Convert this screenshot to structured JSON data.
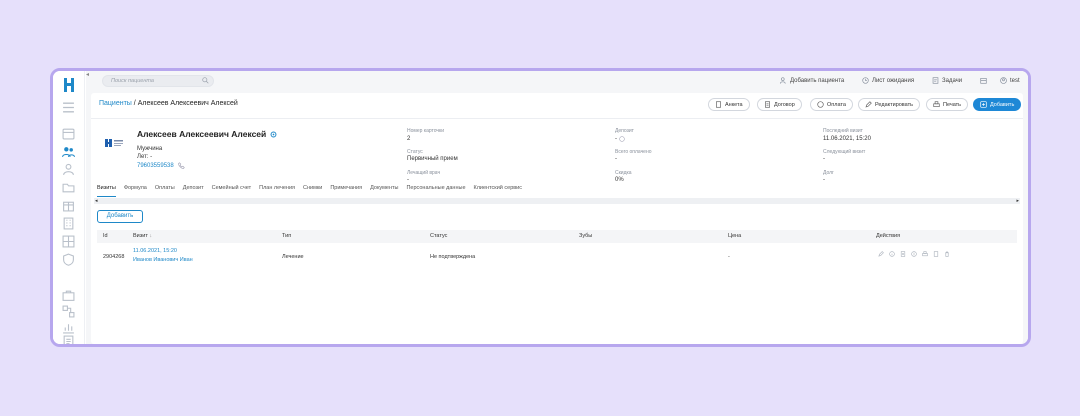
{
  "topbar": {
    "search_placeholder": "Поиск пациента",
    "add_patient": "Добавить пациента",
    "waitlist": "Лист ожидания",
    "tasks": "Задачи",
    "user": "test"
  },
  "header": {
    "breadcrumb_link": "Пациенты",
    "breadcrumb_sep": " / ",
    "breadcrumb_current": "Алексеев Алексеевич Алексей",
    "buttons": {
      "anketa": "Анкета",
      "dogovor": "Договор",
      "oplata": "Оплата",
      "edit": "Редактировать",
      "print": "Печать",
      "add": "Добавить"
    }
  },
  "patient": {
    "name": "Алексеев Алексеевич Алексей",
    "gender": "Мужчина",
    "age": "Лет: -",
    "phone": "79603559538",
    "info": {
      "card_number_label": "Номер карточки",
      "card_number": "2",
      "status_label": "Статус",
      "status": "Первичный прием",
      "doctor_label": "Лечащий врач",
      "doctor": "-",
      "deposit_label": "Депозит",
      "deposit": "-",
      "total_paid_label": "Всего оплачено",
      "total_paid": "-",
      "discount_label": "Скидка",
      "discount": "0%",
      "last_visit_label": "Последний визит",
      "last_visit": "11.06.2021, 15:20",
      "next_visit_label": "Следующий визит",
      "next_visit": "-",
      "debt_label": "Долг",
      "debt": "-"
    }
  },
  "tabs": [
    "Визиты",
    "Формула",
    "Оплаты",
    "Депозит",
    "Семейный счет",
    "План лечения",
    "Снимки",
    "Примечания",
    "Документы",
    "Персональные данные",
    "Клиентский сервис"
  ],
  "visits": {
    "add_label": "Добавить",
    "columns": {
      "id": "Id",
      "visit": "Визит",
      "type": "Тип",
      "status": "Статус",
      "teeth": "Зубы",
      "price": "Цена",
      "actions": "Действия"
    },
    "rows": [
      {
        "id": "2904268",
        "date": "11.06.2021, 15:20",
        "doctor": "Иванов Иванович Иван",
        "type": "Лечение",
        "status": "Не подтверждена",
        "teeth": "",
        "price": "-"
      }
    ]
  },
  "colors": {
    "accent": "#1e88c8",
    "frame": "#b7a7ee",
    "background": "#e6e0fb"
  }
}
